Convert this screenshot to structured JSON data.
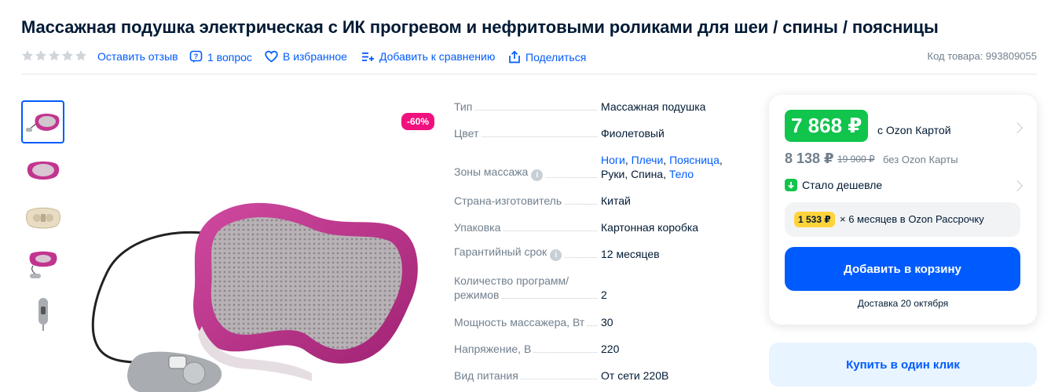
{
  "product": {
    "title": "Массажная подушка электрическая с ИК прогревом и нефритовыми роликами для шеи / спины / поясницы",
    "code_label": "Код товара: 993809055"
  },
  "meta": {
    "rating_stars": 5,
    "review_label": "Оставить отзыв",
    "questions_label": "1 вопрос",
    "favorite_label": "В избранное",
    "compare_label": "Добавить к сравнению",
    "share_label": "Поделиться"
  },
  "gallery": {
    "discount_badge": "-60%",
    "thumbnail_count": 5
  },
  "specs": {
    "rows": [
      {
        "key": "Тип",
        "value": "Массажная подушка"
      },
      {
        "key": "Цвет",
        "value": "Фиолетовый"
      },
      {
        "key": "Зоны массажа",
        "zones": [
          {
            "text": "Ноги",
            "link": true
          },
          {
            "text": ", ",
            "link": false
          },
          {
            "text": "Плечи",
            "link": true
          },
          {
            "text": ", ",
            "link": false
          },
          {
            "text": "Поясница",
            "link": true
          },
          {
            "text": ",",
            "link": false
          },
          {
            "text": "Руки, Спина, ",
            "link": false
          },
          {
            "text": "Тело",
            "link": true
          }
        ]
      },
      {
        "key": "Страна-изготовитель",
        "value": "Китай"
      },
      {
        "key": "Упаковка",
        "value": "Картонная коробка"
      },
      {
        "key": "Гарантийный срок",
        "value": "12 месяцев"
      },
      {
        "key_line1": "Количество программ/",
        "key_line2": "режимов",
        "value": "2"
      },
      {
        "key": "Мощность массажера, Вт",
        "value": "30"
      },
      {
        "key": "Напряжение, В",
        "value": "220"
      },
      {
        "key": "Вид питания",
        "value": "От сети 220В"
      }
    ]
  },
  "pricing": {
    "card_price": "7 868 ₽",
    "card_label": "с Ozon Картой",
    "regular_price": "8 138 ₽",
    "old_price": "19 900 ₽",
    "without_card_label": "без Ozon Карты",
    "cheaper_label": "Стало дешевле",
    "installment_price": "1 533 ₽",
    "installment_text": "× 6 месяцев в Ozon Рассрочку",
    "add_to_cart_label": "Добавить в корзину",
    "delivery_label": "Доставка 20 октября",
    "buy_one_click_label": "Купить в один клик"
  },
  "colors": {
    "brand_blue": "#005bff",
    "ozon_card_green": "#10c44c",
    "discount_pink": "#f1117e",
    "installment_yellow": "#ffd43a",
    "product_magenta": "#c2358f"
  }
}
